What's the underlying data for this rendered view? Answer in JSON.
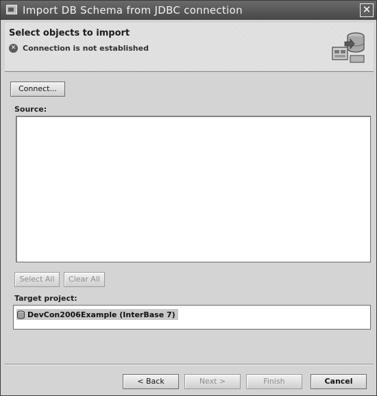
{
  "window": {
    "title": "Import DB Schema from JDBC connection",
    "close_glyph": "✕",
    "app_icon": "dialog-app-icon"
  },
  "banner": {
    "title": "Select objects to import",
    "status_text": "Connection is not established",
    "status_icon": "error-icon",
    "status_icon_glyph": "✕",
    "illustration": "database-import-icon"
  },
  "connect_button": "Connect...",
  "source": {
    "label": "Source:"
  },
  "selection_buttons": {
    "select_all": "Select All",
    "clear_all": "Clear All"
  },
  "target": {
    "label": "Target project:",
    "project": "DevCon2006Example (InterBase 7)",
    "project_icon": "database-project-icon"
  },
  "footer": {
    "back": "< Back",
    "next": "Next >",
    "finish": "Finish",
    "cancel": "Cancel"
  }
}
